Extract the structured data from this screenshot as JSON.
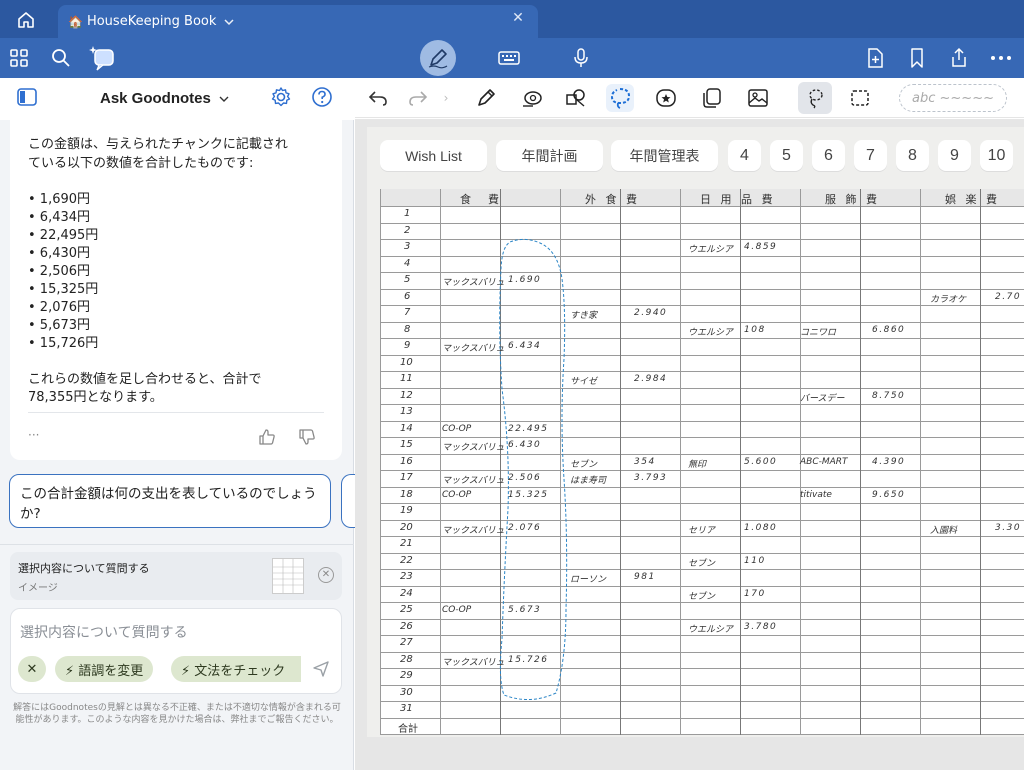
{
  "tab": {
    "title": "HouseKeeping Book",
    "emoji": "🏠"
  },
  "ask": {
    "title": "Ask Goodnotes",
    "answer_intro": [
      "この金額は、与えられたチャンクに記載され",
      "ている以下の数値を合計したものです:"
    ],
    "amounts": [
      "• 1,690円",
      "• 6,434円",
      "• 22,495円",
      "• 6,430円",
      "• 2,506円",
      "• 15,325円",
      "• 2,076円",
      "• 5,673円",
      "• 15,726円"
    ],
    "conclusion": [
      "これらの数値を足し合わせると、合計で",
      "78,355円となります。"
    ],
    "more": "···",
    "suggestion": "この合計金額は何の支出を表しているのでしょうか?",
    "selection_title": "選択内容について質問する",
    "selection_sub": "イメージ",
    "input_placeholder": "選択内容について質問する",
    "chip_x": "✕",
    "chip1": "⚡ 語調を変更",
    "chip2": "⚡ 文法をチェック",
    "disclaimer": "解答にはGoodnotesの見解とは異なる不正確、または不適切な情報が含まれる可能性があります。このような内容を見かけた場合は、弊社までご報告ください。"
  },
  "tools": {
    "lasso_hint": "abc ~~~~~"
  },
  "nav_tabs": [
    "Wish List",
    "年間計画",
    "年間管理表",
    "4",
    "5",
    "6",
    "7",
    "8",
    "9",
    "10"
  ],
  "ledger": {
    "headers": [
      "食　費",
      "外 食 費",
      "日 用 品 費",
      "服 飾 費",
      "娯 楽 費"
    ],
    "rows": [
      "1",
      "2",
      "3",
      "4",
      "5",
      "6",
      "7",
      "8",
      "9",
      "10",
      "11",
      "12",
      "13",
      "14",
      "15",
      "16",
      "17",
      "18",
      "19",
      "20",
      "21",
      "22",
      "23",
      "24",
      "25",
      "26",
      "27",
      "28",
      "29",
      "30",
      "31"
    ],
    "total_label": "合計",
    "entries": [
      {
        "row": 3,
        "col": "nichiyo_name",
        "text": "ウエルシア"
      },
      {
        "row": 3,
        "col": "nichiyo_val",
        "text": "4.859"
      },
      {
        "row": 5,
        "col": "shoku_name",
        "text": "マックスバリュ"
      },
      {
        "row": 5,
        "col": "shoku_val",
        "text": "1.690"
      },
      {
        "row": 6,
        "col": "goraku_name",
        "text": "カラオケ"
      },
      {
        "row": 6,
        "col": "goraku_val",
        "text": "2.70"
      },
      {
        "row": 7,
        "col": "gaishoku_name",
        "text": "すき家"
      },
      {
        "row": 7,
        "col": "gaishoku_val",
        "text": "2.940"
      },
      {
        "row": 8,
        "col": "nichiyo_name",
        "text": "ウエルシア"
      },
      {
        "row": 8,
        "col": "nichiyo_val",
        "text": "108"
      },
      {
        "row": 8,
        "col": "fuku_name",
        "text": "コニワロ"
      },
      {
        "row": 8,
        "col": "fuku_val",
        "text": "6.860"
      },
      {
        "row": 9,
        "col": "shoku_name",
        "text": "マックスバリュ"
      },
      {
        "row": 9,
        "col": "shoku_val",
        "text": "6.434"
      },
      {
        "row": 11,
        "col": "gaishoku_name",
        "text": "サイゼ"
      },
      {
        "row": 11,
        "col": "gaishoku_val",
        "text": "2.984"
      },
      {
        "row": 12,
        "col": "fuku_name",
        "text": "バースデー"
      },
      {
        "row": 12,
        "col": "fuku_val",
        "text": "8.750"
      },
      {
        "row": 14,
        "col": "shoku_name",
        "text": "CO-OP"
      },
      {
        "row": 14,
        "col": "shoku_val",
        "text": "22.495"
      },
      {
        "row": 15,
        "col": "shoku_name",
        "text": "マックスバリュ"
      },
      {
        "row": 15,
        "col": "shoku_val",
        "text": "6.430"
      },
      {
        "row": 16,
        "col": "gaishoku_name",
        "text": "セブン"
      },
      {
        "row": 16,
        "col": "gaishoku_val",
        "text": "354"
      },
      {
        "row": 16,
        "col": "nichiyo_name",
        "text": "無印"
      },
      {
        "row": 16,
        "col": "nichiyo_val",
        "text": "5.600"
      },
      {
        "row": 16,
        "col": "fuku_name",
        "text": "ABC-MART"
      },
      {
        "row": 16,
        "col": "fuku_val",
        "text": "4.390"
      },
      {
        "row": 17,
        "col": "shoku_name",
        "text": "マックスバリュ"
      },
      {
        "row": 17,
        "col": "shoku_val",
        "text": "2.506"
      },
      {
        "row": 17,
        "col": "gaishoku_name",
        "text": "はま寿司"
      },
      {
        "row": 17,
        "col": "gaishoku_val",
        "text": "3.793"
      },
      {
        "row": 18,
        "col": "shoku_name",
        "text": "CO-OP"
      },
      {
        "row": 18,
        "col": "shoku_val",
        "text": "15.325"
      },
      {
        "row": 18,
        "col": "fuku_name",
        "text": "titivate"
      },
      {
        "row": 18,
        "col": "fuku_val",
        "text": "9.650"
      },
      {
        "row": 20,
        "col": "shoku_name",
        "text": "マックスバリュ"
      },
      {
        "row": 20,
        "col": "shoku_val",
        "text": "2.076"
      },
      {
        "row": 20,
        "col": "nichiyo_name",
        "text": "セリア"
      },
      {
        "row": 20,
        "col": "nichiyo_val",
        "text": "1.080"
      },
      {
        "row": 20,
        "col": "goraku_name",
        "text": "入園料"
      },
      {
        "row": 20,
        "col": "goraku_val",
        "text": "3.30"
      },
      {
        "row": 22,
        "col": "nichiyo_name",
        "text": "セブン"
      },
      {
        "row": 22,
        "col": "nichiyo_val",
        "text": "110"
      },
      {
        "row": 23,
        "col": "gaishoku_name",
        "text": "ローソン"
      },
      {
        "row": 23,
        "col": "gaishoku_val",
        "text": "981"
      },
      {
        "row": 24,
        "col": "nichiyo_name",
        "text": "セブン"
      },
      {
        "row": 24,
        "col": "nichiyo_val",
        "text": "170"
      },
      {
        "row": 25,
        "col": "shoku_name",
        "text": "CO-OP"
      },
      {
        "row": 25,
        "col": "shoku_val",
        "text": "5.673"
      },
      {
        "row": 26,
        "col": "nichiyo_name",
        "text": "ウエルシア"
      },
      {
        "row": 26,
        "col": "nichiyo_val",
        "text": "3.780"
      },
      {
        "row": 28,
        "col": "shoku_name",
        "text": "マックスバリュ"
      },
      {
        "row": 28,
        "col": "shoku_val",
        "text": "15.726"
      }
    ]
  },
  "colors": {
    "tabbar": "#2c58a0",
    "toolbar": "#3768b5",
    "accent": "#3a72c0",
    "chip": "#dde7cf"
  }
}
